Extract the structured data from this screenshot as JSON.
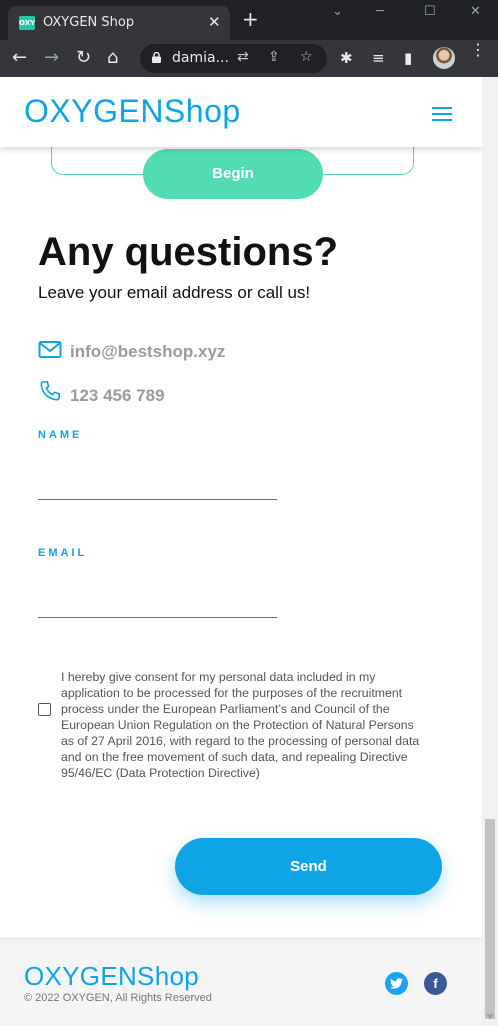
{
  "browser": {
    "tab_favicon": "OXY",
    "tab_title": "OXYGEN Shop",
    "tab_close": "✕",
    "new_tab": "+",
    "url": "damia...",
    "window_controls": {
      "minimize": "─",
      "maximize": "☐",
      "close": "✕",
      "chevron": "⌄"
    }
  },
  "header": {
    "logo": "OXYGENShop",
    "menu_icon": "hamburger-icon"
  },
  "pricing": {
    "begin_label": "Begin"
  },
  "questions": {
    "title": "Any questions?",
    "subtitle": "Leave your email address or call us!",
    "email": "info@bestshop.xyz",
    "phone": "123 456 789"
  },
  "form": {
    "name_label": "NAME",
    "name_value": "",
    "email_label": "EMAIL",
    "email_value": "",
    "consent_checked": false,
    "consent_text": "I hereby give consent for my personal data included in my application to be processed for the purposes of the recruitment process under the European Parliament’s and Council of the European Union Regulation on the Protection of Natural Persons as of 27 April 2016, with regard to the processing of personal data and on the free movement of such data, and repealing Directive 95/46/EC (Data Protection Directive)",
    "send_label": "Send"
  },
  "footer": {
    "logo": "OXYGENShop",
    "copyright": "© 2022 OXYGEN, All Rights Reserved",
    "social": [
      {
        "icon": "twitter-icon",
        "color": "#1da1f2"
      },
      {
        "icon": "facebook-icon",
        "color": "#3b5998"
      }
    ]
  },
  "colors": {
    "brand_blue": "#0ea4e6",
    "begin_green": "#52dcb4",
    "muted_text": "#9b9b9b"
  }
}
